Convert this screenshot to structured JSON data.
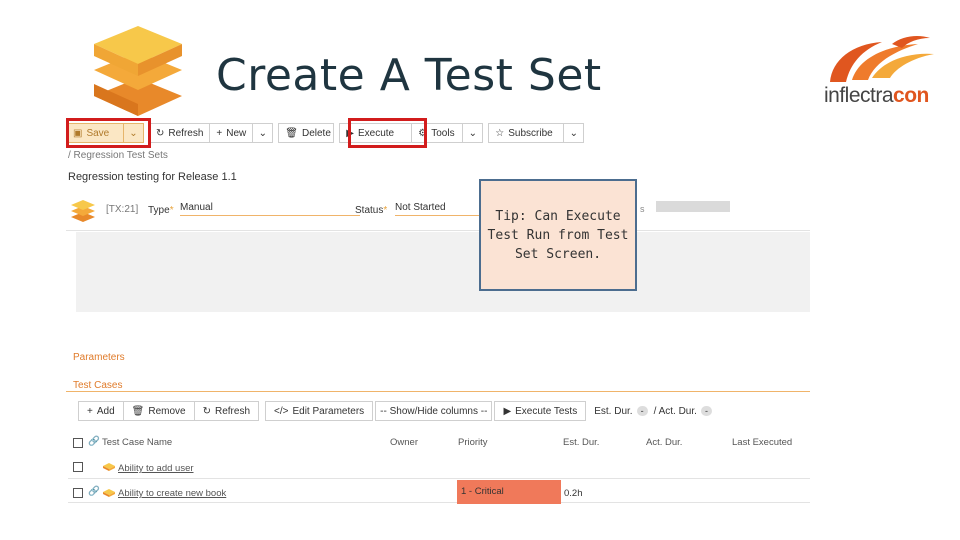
{
  "slide": {
    "title": "Create A Test Set",
    "brand_left": "inflectra",
    "brand_right": "con"
  },
  "toolbar": {
    "save": "Save",
    "refresh": "Refresh",
    "new": "New",
    "delete": "Delete",
    "execute": "Execute",
    "tools": "Tools",
    "subscribe": "Subscribe"
  },
  "breadcrumb": "/ Regression Test Sets",
  "page_desc": "Regression testing for Release 1.1",
  "props": {
    "id": "[TX:21]",
    "type_label": "Type",
    "type_value": "Manual",
    "status_label": "Status",
    "status_value": "Not Started",
    "owner_partial": "s"
  },
  "tip": {
    "line1": "Tip: Can Execute",
    "line2": "Test Run from Test",
    "line3": "Set Screen."
  },
  "sections": {
    "parameters": "Parameters",
    "test_cases": "Test Cases"
  },
  "tc_toolbar": {
    "add": "Add",
    "remove": "Remove",
    "refresh": "Refresh",
    "edit_params": "Edit Parameters",
    "show_hide": "-- Show/Hide columns --",
    "execute_tests": "Execute Tests",
    "est_dur": "Est. Dur.",
    "est_val": "-",
    "act_dur": "/ Act. Dur.",
    "act_val": "-"
  },
  "table": {
    "columns": [
      "Test Case Name",
      "Owner",
      "Priority",
      "Est. Dur.",
      "Act. Dur.",
      "Last Executed"
    ],
    "rows": [
      {
        "name": "Ability to add user",
        "owner": "",
        "priority": "",
        "est": "",
        "act": "",
        "last": ""
      },
      {
        "name": "Ability to create new book",
        "owner": "",
        "priority": "1 - Critical",
        "est": "0.2h",
        "act": "",
        "last": ""
      }
    ]
  },
  "colors": {
    "highlight": "#d21c1c",
    "accent": "#e07b2a",
    "critical": "#f0795a",
    "title": "#1f3540"
  }
}
